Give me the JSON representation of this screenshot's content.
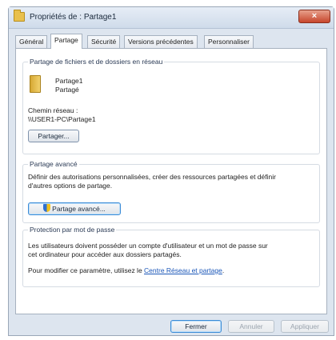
{
  "window": {
    "title": "Propriétés de : Partage1",
    "close_label": "×"
  },
  "tabs": [
    {
      "label": "Général"
    },
    {
      "label": "Partage"
    },
    {
      "label": "Sécurité"
    },
    {
      "label": "Versions précédentes"
    },
    {
      "label": "Personnaliser"
    }
  ],
  "network_sharing": {
    "legend": "Partage de fichiers et de dossiers en réseau",
    "share_name": "Partage1",
    "share_status": "Partagé",
    "path_label": "Chemin réseau :",
    "path_value": "\\\\USER1-PC\\Partage1",
    "share_button": "Partager..."
  },
  "advanced_sharing": {
    "legend": "Partage avancé",
    "description_1": "Définir des autorisations personnalisées, créer des ressources partagées et définir",
    "description_2": "d'autres options de partage.",
    "button": "Partage avancé..."
  },
  "password_protection": {
    "legend": "Protection par mot de passe",
    "description_1": "Les utilisateurs doivent posséder un compte d'utilisateur et un mot de passe sur",
    "description_2": "cet ordinateur pour accéder aux dossiers partagés.",
    "modify_prefix": "Pour modifier ce paramètre, utilisez le ",
    "link": "Centre Réseau et partage",
    "modify_suffix": "."
  },
  "footer": {
    "close": "Fermer",
    "cancel": "Annuler",
    "apply": "Appliquer"
  },
  "icons": {
    "window": "folder-icon",
    "share": "folder-icon",
    "advanced": "shield-icon"
  }
}
